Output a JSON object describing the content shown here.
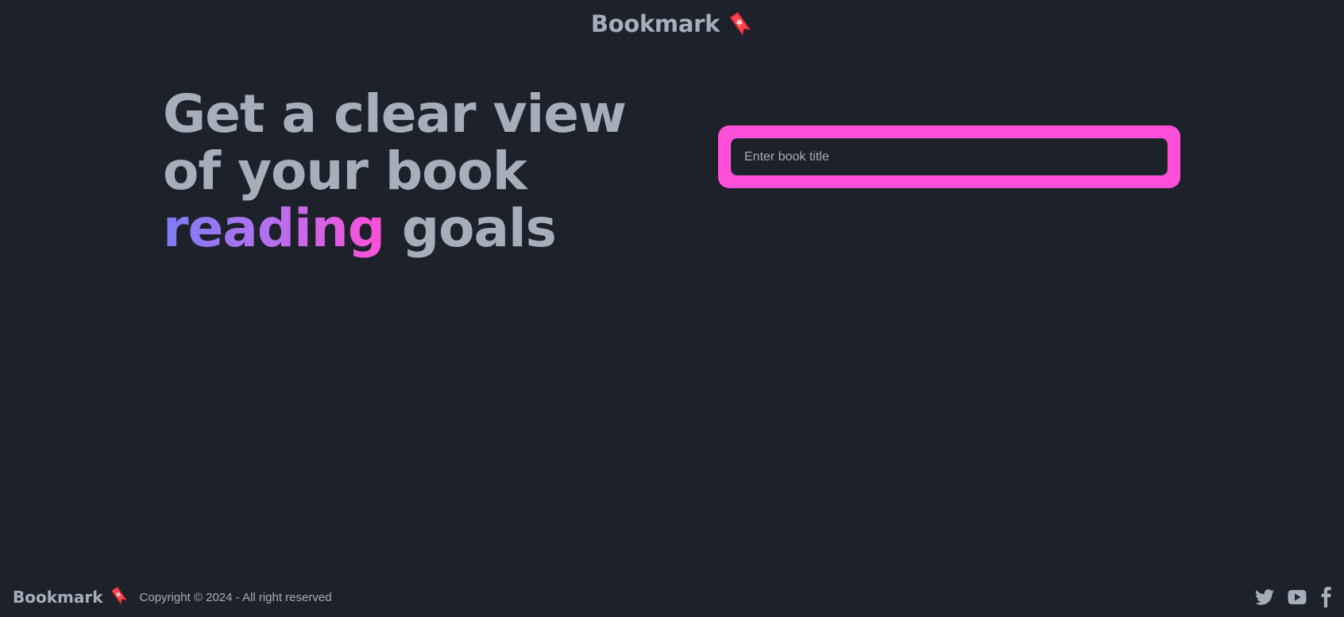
{
  "header": {
    "brand": "Bookmark",
    "brand_icon": "bookmark-ribbon-icon"
  },
  "hero": {
    "title_part1": "Get a clear view of your book ",
    "title_accent": "reading",
    "title_part2": " goals",
    "accent_gradient": [
      "#7b7cf6",
      "#b172f0",
      "#ff4fd8"
    ]
  },
  "search": {
    "placeholder": "Enter book title",
    "value": "",
    "frame_color": "#ff4fd8"
  },
  "footer": {
    "brand": "Bookmark",
    "copyright": "Copyright © 2024 - All right reserved",
    "social": [
      {
        "icon": "twitter-icon"
      },
      {
        "icon": "youtube-icon"
      },
      {
        "icon": "facebook-icon"
      }
    ]
  },
  "colors": {
    "background": "#1d212a",
    "text": "#a6adbb",
    "brand_icon_red": "#ef2b3a"
  }
}
